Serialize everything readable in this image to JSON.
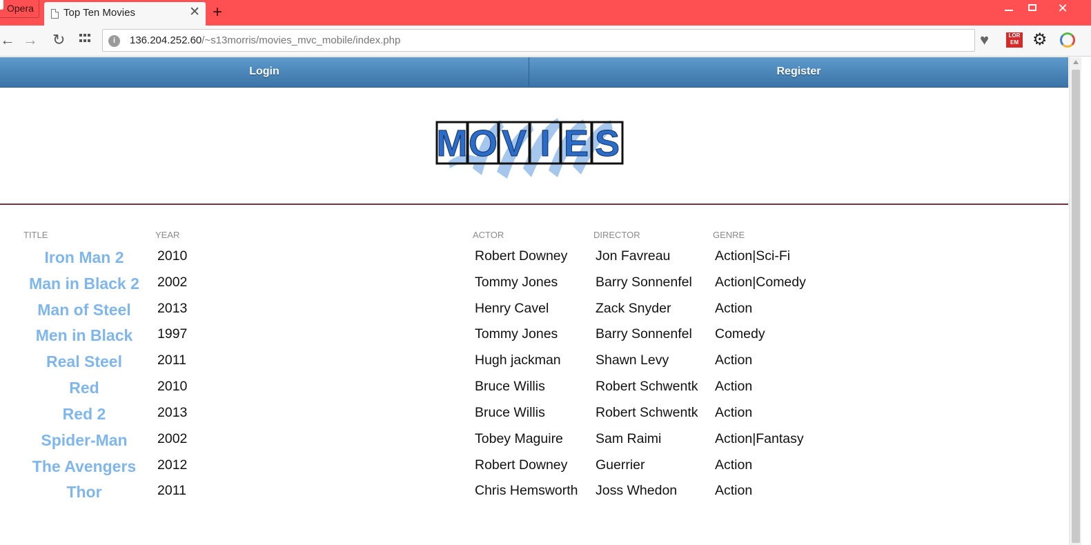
{
  "browser": {
    "menu_label": "Opera",
    "tab_title": "Top Ten Movies",
    "tab_close": "✕",
    "new_tab": "+",
    "url_host": "136.204.252.60",
    "url_path": "/~s13morris/movies_mvc_mobile/index.php"
  },
  "nav": {
    "login": "Login",
    "register": "Register"
  },
  "logo": {
    "letters": [
      "M",
      "O",
      "V",
      "I",
      "E",
      "S"
    ]
  },
  "table": {
    "headers": {
      "title": "TITLE",
      "year": "YEAR",
      "actor": "ACTOR",
      "director": "DIRECTOR",
      "genre": "GENRE"
    },
    "rows": [
      {
        "title": "Iron Man 2",
        "year": "2010",
        "actor": "Robert Downey",
        "director": "Jon Favreau",
        "genre": "Action|Sci-Fi"
      },
      {
        "title": "Man in Black 2",
        "year": "2002",
        "actor": "Tommy Jones",
        "director": "Barry Sonnenfel",
        "genre": "Action|Comedy"
      },
      {
        "title": "Man of Steel",
        "year": "2013",
        "actor": "Henry Cavel",
        "director": "Zack Snyder",
        "genre": "Action"
      },
      {
        "title": "Men in Black",
        "year": "1997",
        "actor": "Tommy Jones",
        "director": "Barry Sonnenfel",
        "genre": "Comedy"
      },
      {
        "title": "Real Steel",
        "year": "2011",
        "actor": "Hugh jackman",
        "director": "Shawn Levy",
        "genre": "Action"
      },
      {
        "title": "Red",
        "year": "2010",
        "actor": "Bruce Willis",
        "director": "Robert Schwentk",
        "genre": "Action"
      },
      {
        "title": "Red 2",
        "year": "2013",
        "actor": "Bruce Willis",
        "director": "Robert Schwentk",
        "genre": "Action"
      },
      {
        "title": "Spider-Man",
        "year": "2002",
        "actor": "Tobey Maguire",
        "director": "Sam Raimi",
        "genre": "Action|Fantasy"
      },
      {
        "title": "The Avengers",
        "year": "2012",
        "actor": "Robert Downey",
        "director": "Guerrier",
        "genre": "Action"
      },
      {
        "title": "Thor",
        "year": "2011",
        "actor": "Chris Hemsworth",
        "director": "Joss Whedon",
        "genre": "Action"
      }
    ]
  },
  "colors": {
    "titlebar": "#fe5053",
    "navbar": "#4a85ba",
    "movie_title": "#7fb6ec",
    "logo_letters": "#2c6cc9"
  }
}
